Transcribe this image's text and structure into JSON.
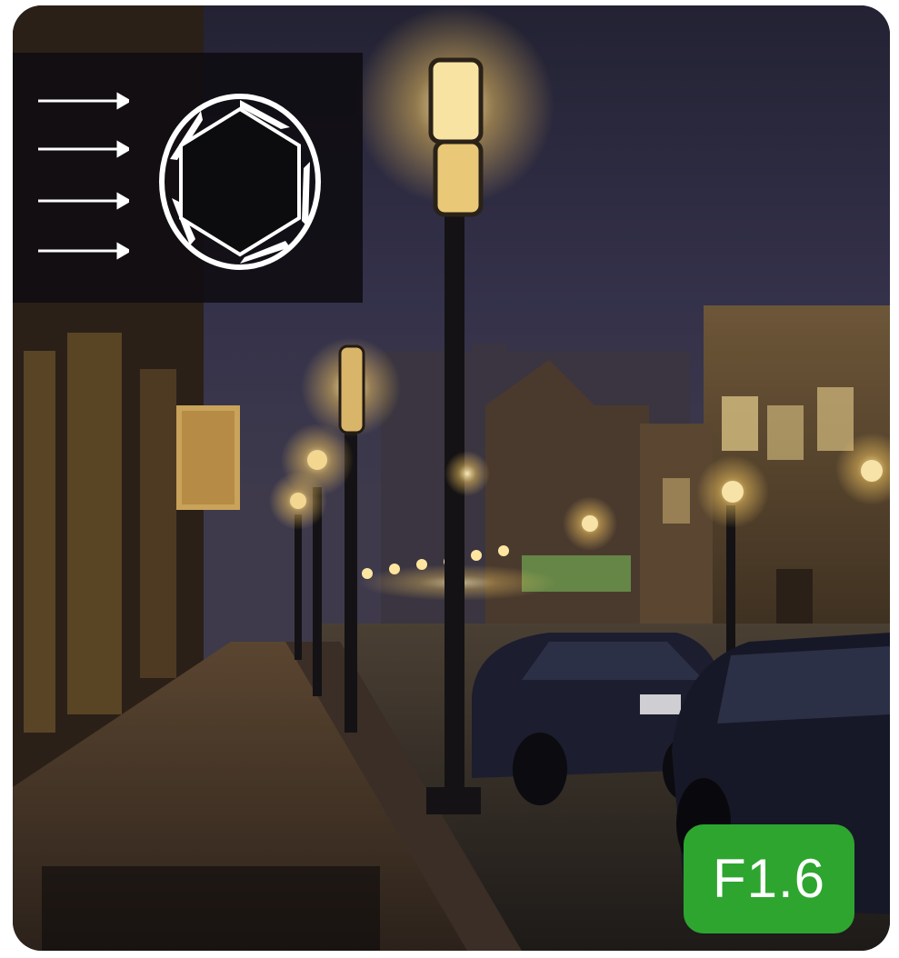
{
  "scene": {
    "description_icon": "night-street-photo"
  },
  "overlay": {
    "aperture_icon": "aperture-icon",
    "arrow_icon": "arrow-right-icon",
    "arrow_count": 4
  },
  "badge": {
    "fstop_label": "F1.6",
    "color": "#2ea52f"
  },
  "colors": {
    "sky": "#2c2a3c",
    "lamp_glow": "#f5d98a",
    "panel": "#0e0c10"
  }
}
